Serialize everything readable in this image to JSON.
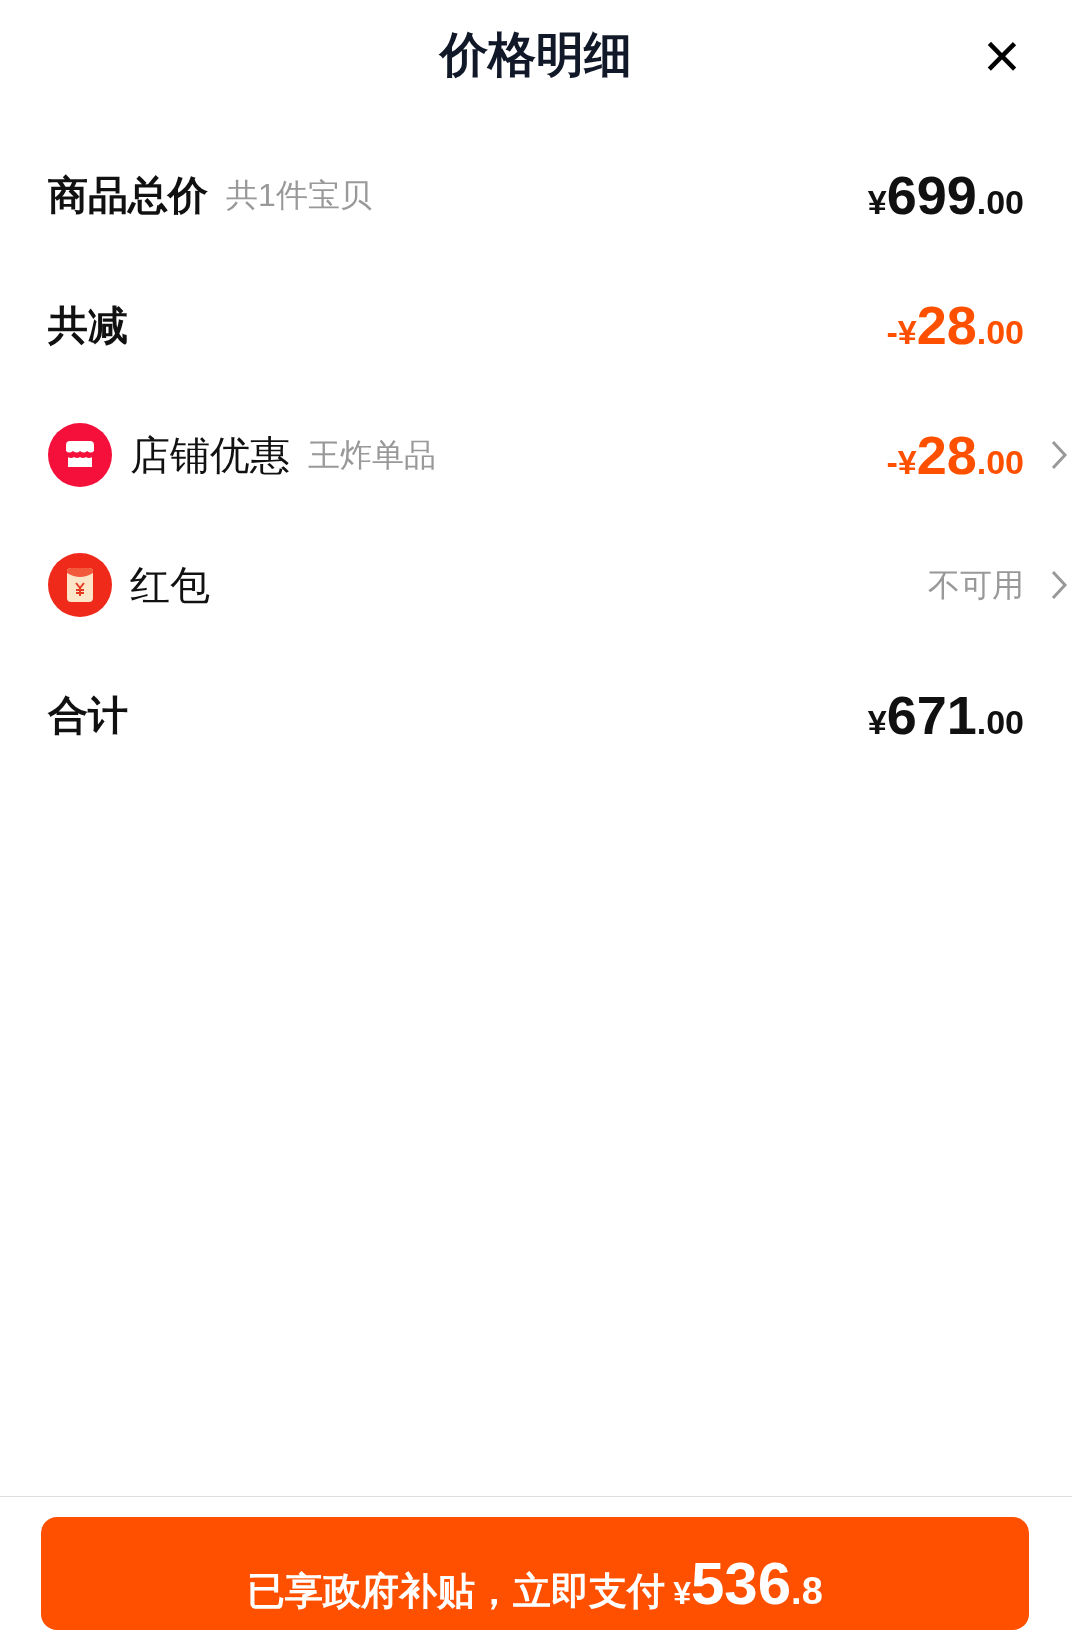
{
  "header": {
    "title": "价格明细",
    "close": "×"
  },
  "rows": [
    {
      "kind": "plain",
      "label": "商品总价",
      "note": "共1件宝贝",
      "amount": {
        "prefix": "¥",
        "integer": "699",
        "fraction": ".00",
        "discount": false
      },
      "chevron": false
    },
    {
      "kind": "plain",
      "label": "共减",
      "amount": {
        "prefix": "-¥",
        "integer": "28",
        "fraction": ".00",
        "discount": true
      },
      "chevron": false
    },
    {
      "kind": "shop",
      "label": "店铺优惠",
      "note": "王炸单品",
      "amount": {
        "prefix": "-¥",
        "integer": "28",
        "fraction": ".00",
        "discount": true
      },
      "chevron": true
    },
    {
      "kind": "envelope",
      "label": "红包",
      "status": "不可用",
      "chevron": true
    },
    {
      "kind": "plain",
      "label": "合计",
      "amount": {
        "prefix": "¥",
        "integer": "671",
        "fraction": ".00",
        "discount": false
      },
      "chevron": false
    }
  ],
  "pay_button": {
    "label": "已享政府补贴，立即支付",
    "prefix": "¥",
    "integer": "536",
    "fraction": ".8"
  }
}
